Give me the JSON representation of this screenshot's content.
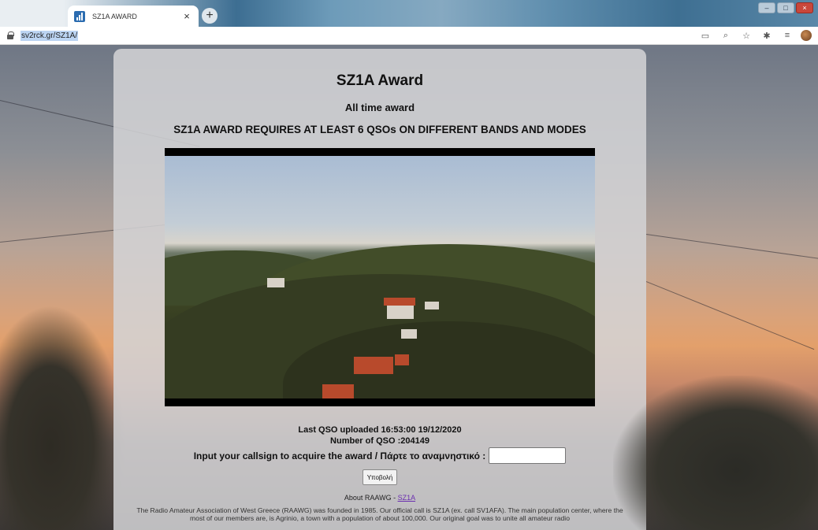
{
  "browser": {
    "tab_title": "SZ1A AWARD",
    "tab_close": "×",
    "new_tab": "+",
    "url": "sv2rck.gr/SZ1A/",
    "window_minimize": "–",
    "window_maximize": "□",
    "window_close": "×"
  },
  "page": {
    "title": "SZ1A Award",
    "subtitle": "All time award",
    "requirement": "SZ1A AWARD REQUIRES AT LEAST 6 QSOs ON DIFFERENT BANDS AND MODES",
    "last_qso": "Last QSO uploaded 16:53:00 19/12/2020",
    "number_of_qso": "Number of QSO :204149",
    "callsign_label": "Input your callsign to acquire the award / Πάρτε το αναμνηστικό :",
    "callsign_value": "",
    "submit_label": "Υποβολή",
    "about_prefix": "About RAAWG - ",
    "about_link": "SZ1A",
    "description": "The Radio Amateur Association of West Greece (RAAWG) was founded in 1985. Our official call is SZ1A (ex. call SV1AFA). The main population center, where the most of our members are, is Agrinio, a town with a population of about 100,000. Our original goal was to unite all amateur radio"
  }
}
